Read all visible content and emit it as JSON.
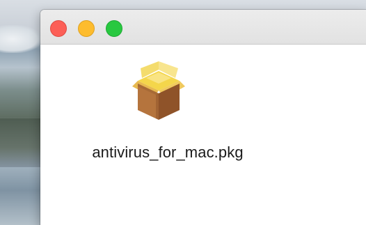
{
  "window": {
    "buttons": {
      "close_color": "#fc5f57",
      "minimize_color": "#fdbc2e",
      "zoom_color": "#28c840"
    }
  },
  "content": {
    "items": [
      {
        "name": "antivirus_for_mac.pkg",
        "icon": "package-icon"
      }
    ]
  },
  "desktop": {
    "wallpaper": "landscape"
  }
}
